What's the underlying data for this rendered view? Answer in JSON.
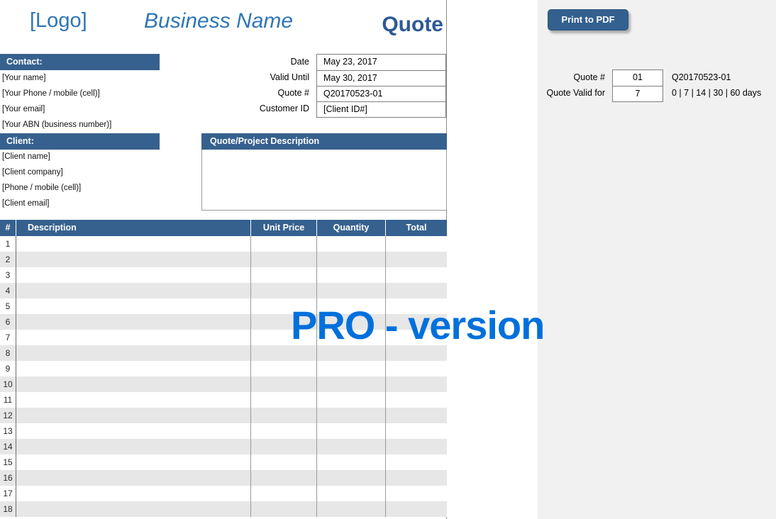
{
  "header": {
    "logo": "[Logo]",
    "business_name": "Business Name",
    "doc_title": "Quote"
  },
  "contact": {
    "title": "Contact:",
    "items": [
      "[Your name]",
      "[Your Phone / mobile (cell)]",
      "[Your email]",
      "[Your ABN (business number)]"
    ]
  },
  "client": {
    "title": "Client:",
    "items": [
      "[Client name]",
      "[Client company]",
      "[Phone / mobile (cell)]",
      "[Client email]"
    ]
  },
  "quote_info": {
    "rows": [
      {
        "label": "Date",
        "value": "May 23, 2017"
      },
      {
        "label": "Valid Until",
        "value": "May 30, 2017"
      },
      {
        "label": "Quote #",
        "value": "Q20170523-01"
      },
      {
        "label": "Customer ID",
        "value": "[Client ID#]"
      }
    ]
  },
  "description": {
    "title": "Quote/Project Description",
    "content": ""
  },
  "items_table": {
    "columns": [
      "#",
      "Description",
      "Unit Price",
      "Quantity",
      "Total"
    ],
    "row_numbers": [
      "1",
      "2",
      "3",
      "4",
      "5",
      "6",
      "7",
      "8",
      "9",
      "10",
      "11",
      "12",
      "13",
      "14",
      "15",
      "16",
      "17",
      "18"
    ]
  },
  "watermark": "PRO - version",
  "side_panel": {
    "print_button_label": "Print to PDF",
    "quote_number": {
      "label": "Quote #",
      "value": "01",
      "hint": "Q20170523-01"
    },
    "quote_valid": {
      "label": "Quote Valid for",
      "value": "7",
      "hint": "0 | 7 | 14 | 30 | 60 days"
    }
  },
  "colors": {
    "bar_blue": "#36618F",
    "title_blue": "#2D5A96",
    "light_blue": "#2E75B6",
    "watermark_blue": "#0070DC",
    "button_blue": "#33608F",
    "row_gray": "#E7E7E7",
    "panel_gray": "#F1F1F1"
  }
}
